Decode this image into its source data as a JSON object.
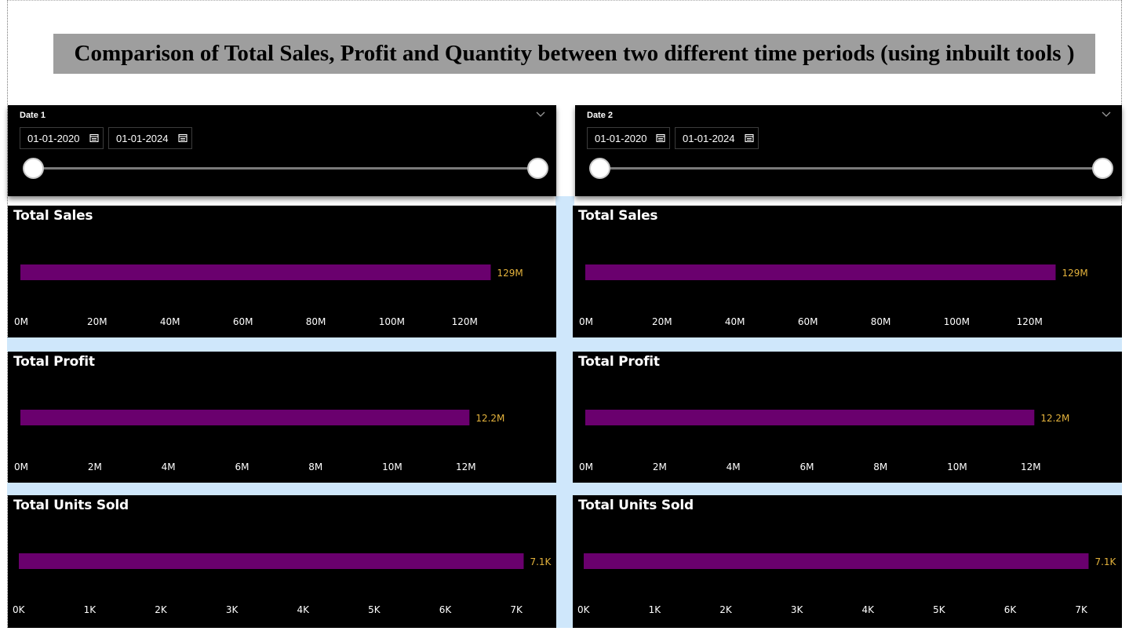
{
  "page": {
    "title": "Comparison of Total Sales, Profit and Quantity between two different time periods (using inbuilt tools )"
  },
  "slicers": [
    {
      "title": "Date 1",
      "start": "01-01-2020",
      "end": "01-01-2024",
      "range_fraction": [
        0,
        1
      ],
      "icon": "chevron-down-icon"
    },
    {
      "title": "Date 2",
      "start": "01-01-2020",
      "end": "01-01-2024",
      "range_fraction": [
        0,
        1
      ],
      "icon": "chevron-down-icon"
    }
  ],
  "colors": {
    "bar": "#6a006e",
    "data_label": "#e3b23c",
    "card_background": "#000000",
    "axis_text": "#ffffff",
    "banner": "#9e9e9e"
  },
  "chart_data": [
    {
      "type": "bar",
      "orientation": "horizontal",
      "panel": "left",
      "title": "Total Sales",
      "values": [
        129
      ],
      "data_labels": [
        "129M"
      ],
      "ticks": [
        "0M",
        "20M",
        "40M",
        "60M",
        "80M",
        "100M",
        "120M"
      ],
      "tick_values": [
        0,
        20,
        40,
        60,
        80,
        100,
        120
      ],
      "xlim": [
        0,
        136
      ],
      "units": "M"
    },
    {
      "type": "bar",
      "orientation": "horizontal",
      "panel": "right",
      "title": "Total Sales",
      "values": [
        129
      ],
      "data_labels": [
        "129M"
      ],
      "ticks": [
        "0M",
        "20M",
        "40M",
        "60M",
        "80M",
        "100M",
        "120M"
      ],
      "tick_values": [
        0,
        20,
        40,
        60,
        80,
        100,
        120
      ],
      "xlim": [
        0,
        136
      ],
      "units": "M"
    },
    {
      "type": "bar",
      "orientation": "horizontal",
      "panel": "left",
      "title": "Total Profit",
      "values": [
        12.2
      ],
      "data_labels": [
        "12.2M"
      ],
      "ticks": [
        "0M",
        "2M",
        "4M",
        "6M",
        "8M",
        "10M",
        "12M"
      ],
      "tick_values": [
        0,
        2,
        4,
        6,
        8,
        10,
        12
      ],
      "xlim": [
        0,
        13.6
      ],
      "units": "M"
    },
    {
      "type": "bar",
      "orientation": "horizontal",
      "panel": "right",
      "title": "Total Profit",
      "values": [
        12.2
      ],
      "data_labels": [
        "12.2M"
      ],
      "ticks": [
        "0M",
        "2M",
        "4M",
        "6M",
        "8M",
        "10M",
        "12M"
      ],
      "tick_values": [
        0,
        2,
        4,
        6,
        8,
        10,
        12
      ],
      "xlim": [
        0,
        13.6
      ],
      "units": "M"
    },
    {
      "type": "bar",
      "orientation": "horizontal",
      "panel": "left",
      "title": "Total Units Sold",
      "values": [
        7.1
      ],
      "data_labels": [
        "7.1K"
      ],
      "ticks": [
        "0K",
        "1K",
        "2K",
        "3K",
        "4K",
        "5K",
        "6K",
        "7K"
      ],
      "tick_values": [
        0,
        1,
        2,
        3,
        4,
        5,
        6,
        7
      ],
      "xlim": [
        0,
        7.15
      ],
      "units": "K"
    },
    {
      "type": "bar",
      "orientation": "horizontal",
      "panel": "right",
      "title": "Total Units Sold",
      "values": [
        7.1
      ],
      "data_labels": [
        "7.1K"
      ],
      "ticks": [
        "0K",
        "1K",
        "2K",
        "3K",
        "4K",
        "5K",
        "6K",
        "7K"
      ],
      "tick_values": [
        0,
        1,
        2,
        3,
        4,
        5,
        6,
        7
      ],
      "xlim": [
        0,
        7.15
      ],
      "units": "K"
    }
  ]
}
